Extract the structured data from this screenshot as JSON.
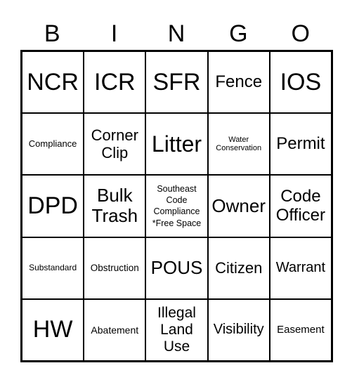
{
  "header": [
    "B",
    "I",
    "N",
    "G",
    "O"
  ],
  "cells": [
    "NCR",
    "ICR",
    "SFR",
    "Fence",
    "IOS",
    "Compliance",
    "Corner Clip",
    "Litter",
    "Water Conservation",
    "Permit",
    "DPD",
    "Bulk Trash",
    "Southeast Code Compliance *Free Space",
    "Owner",
    "Code Officer",
    "Substandard",
    "Obstruction",
    "POUS",
    "Citizen",
    "Warrant",
    "HW",
    "Abatement",
    "Illegal Land Use",
    "Visibility",
    "Easement"
  ]
}
